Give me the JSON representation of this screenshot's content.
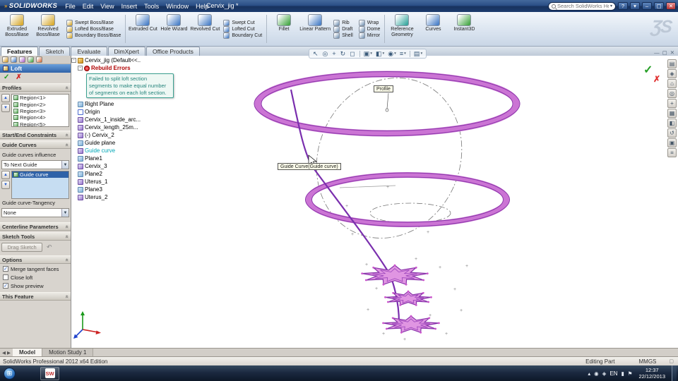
{
  "titlebar": {
    "app_logo": "SOLIDWORKS",
    "logo_mark": "»",
    "menus": [
      "File",
      "Edit",
      "View",
      "Insert",
      "Tools",
      "Window",
      "Help"
    ],
    "doc_title": "Cervix_jig *",
    "search_placeholder": "Search SolidWorks Help",
    "search_caret": "▾",
    "help_btn": "?",
    "help_caret": "▾",
    "minimize": "–",
    "maximize": "▢",
    "close": "✕"
  },
  "ribbon": {
    "ds_logo": "ƷS",
    "cells": [
      {
        "type": "big",
        "label": "Extruded Boss/Base",
        "icon": "extruded-boss",
        "color": "#d8aa30"
      },
      {
        "type": "big",
        "label": "Revolved Boss/Base",
        "icon": "revolved-boss",
        "color": "#d8aa30"
      },
      {
        "type": "stack",
        "items": [
          "Swept Boss/Base",
          "Lofted Boss/Base",
          "Boundary Boss/Base"
        ],
        "color": "#d8aa30"
      },
      {
        "type": "sep"
      },
      {
        "type": "big",
        "label": "Extruded Cut",
        "icon": "extruded-cut",
        "color": "#4a80c8"
      },
      {
        "type": "big",
        "label": "Hole Wizard",
        "icon": "hole-wizard",
        "color": "#4a80c8"
      },
      {
        "type": "big",
        "label": "Revolved Cut",
        "icon": "revolved-cut",
        "color": "#4a80c8"
      },
      {
        "type": "stack",
        "items": [
          "Swept Cut",
          "Lofted Cut",
          "Boundary Cut"
        ],
        "color": "#4a80c8"
      },
      {
        "type": "sep"
      },
      {
        "type": "big",
        "label": "Fillet",
        "icon": "fillet",
        "color": "#48a848"
      },
      {
        "type": "big",
        "label": "Linear Pattern",
        "icon": "linear-pattern",
        "color": "#4a80c8"
      },
      {
        "type": "stack",
        "items": [
          "Rib",
          "Draft",
          "Shell"
        ],
        "color": "#7a98b8"
      },
      {
        "type": "stack",
        "items": [
          "Wrap",
          "Dome",
          "Mirror"
        ],
        "color": "#7a98b8"
      },
      {
        "type": "sep"
      },
      {
        "type": "big",
        "label": "Reference Geometry",
        "icon": "reference-geometry",
        "color": "#3aa8a0"
      },
      {
        "type": "big",
        "label": "Curves",
        "icon": "curves",
        "color": "#4a80c8"
      },
      {
        "type": "big",
        "label": "Instant3D",
        "icon": "instant3d",
        "color": "#48a848"
      }
    ]
  },
  "command_tabs": [
    {
      "label": "Features",
      "active": true
    },
    {
      "label": "Sketch"
    },
    {
      "label": "Evaluate"
    },
    {
      "label": "DimXpert"
    },
    {
      "label": "Office Products"
    }
  ],
  "doc_window_buttons": [
    "—",
    "▢",
    "✕"
  ],
  "pm": {
    "title": "Loft",
    "ok": "✓",
    "cancel": "✗",
    "up_arrow": "▲",
    "down_arrow": "▼",
    "collapse": "«",
    "dd_arrow": "▼",
    "tabs": [
      {
        "name": "featuremanager-tree",
        "color": "#d8a030"
      },
      {
        "name": "propertymanager",
        "color": "#4a80c8"
      },
      {
        "name": "configuration-manager",
        "color": "#b06ad0"
      },
      {
        "name": "dimxpert-manager",
        "color": "#48a848"
      },
      {
        "name": "display-manager",
        "color": "#d87040"
      }
    ],
    "sections": {
      "profiles": {
        "label": "Profiles",
        "items": [
          "Region<1>",
          "Region<2>",
          "Region<3>",
          "Region<4>",
          "Region<5>"
        ]
      },
      "constraints": {
        "label": "Start/End Constraints"
      },
      "guide_curves": {
        "label": "Guide Curves",
        "influence_label": "Guide curves influence",
        "influence_value": "To Next Guide",
        "items": [
          {
            "label": "Guide curve",
            "class": "selected"
          }
        ],
        "tangency_label": "Guide curve-Tangency",
        "tangency_value": "None"
      },
      "centerline": {
        "label": "Centerline Parameters"
      },
      "sketch_tools": {
        "label": "Sketch Tools",
        "drag_label": "Drag Sketch",
        "undo_icon": "↶"
      },
      "options": {
        "label": "Options",
        "checks": [
          {
            "label": "Merge tangent faces",
            "checked": true
          },
          {
            "label": "Close loft",
            "checked": false
          },
          {
            "label": "Show preview",
            "checked": true
          }
        ]
      },
      "this_feature": {
        "label": "This Feature"
      }
    }
  },
  "tree": {
    "expand_glyph": "-",
    "root": "Cervix_jig (Default<<..",
    "error_label": "Rebuild Errors",
    "error_tip": "Failed to split loft section segments to make equal number of segments on each loft section.",
    "items": [
      {
        "label": "Right Plane",
        "icon": "plane"
      },
      {
        "label": "Origin",
        "icon": "origin"
      },
      {
        "label": "Cervix_1_inside_arc...",
        "icon": "sketch"
      },
      {
        "label": "Cervix_length_25m...",
        "icon": "sketch"
      },
      {
        "label": "(-) Cervix_2",
        "icon": "sketch"
      },
      {
        "label": "Guide plane",
        "icon": "plane"
      },
      {
        "label": "Guide curve",
        "icon": "sketch",
        "class": "teal"
      },
      {
        "label": "Plane1",
        "icon": "plane"
      },
      {
        "label": "Cervix_3",
        "icon": "sketch"
      },
      {
        "label": "Plane2",
        "icon": "plane"
      },
      {
        "label": "Uterus_1",
        "icon": "sketch"
      },
      {
        "label": "Plane3",
        "icon": "plane"
      },
      {
        "label": "Uterus_2",
        "icon": "sketch"
      }
    ]
  },
  "graphics": {
    "profile_label": "Profile",
    "guide_tooltip": "Guide Curve(Guide curve)",
    "ok": "✓",
    "cancel": "✗"
  },
  "headsup": [
    {
      "g": "↖"
    },
    {
      "g": "◎"
    },
    {
      "g": "+"
    },
    {
      "g": "↻"
    },
    {
      "g": "◻"
    },
    {
      "type": "sep"
    },
    {
      "g": "▣",
      "caret": "▾"
    },
    {
      "g": "◧",
      "caret": "▾"
    },
    {
      "g": "◉",
      "caret": "▾"
    },
    {
      "g": "≡",
      "caret": "▾"
    },
    {
      "type": "sep"
    },
    {
      "g": "▤",
      "caret": "▾"
    }
  ],
  "right_toolbar": [
    "▤",
    "◈",
    "⌂",
    "◎",
    "+",
    "▦",
    "◧",
    "↺",
    "▣",
    "≡"
  ],
  "doc_tabs": {
    "nav": [
      "◀",
      "▶"
    ],
    "items": [
      {
        "label": "Model",
        "active": true
      },
      {
        "label": "Motion Study 1"
      }
    ]
  },
  "statusbar": {
    "left": "SolidWorks Professional 2012 x64 Edition",
    "editing": "Editing Part",
    "units": "MMGS",
    "icon": "▢"
  },
  "taskbar": {
    "start_glyph": "⊞",
    "sw_label": "SW",
    "tray_icons": [
      "▴",
      "◉",
      "◈"
    ],
    "lang": "EN",
    "tray_icons2": [
      "▮",
      "⚑"
    ],
    "time": "12:37",
    "date": "22/12/2013"
  }
}
